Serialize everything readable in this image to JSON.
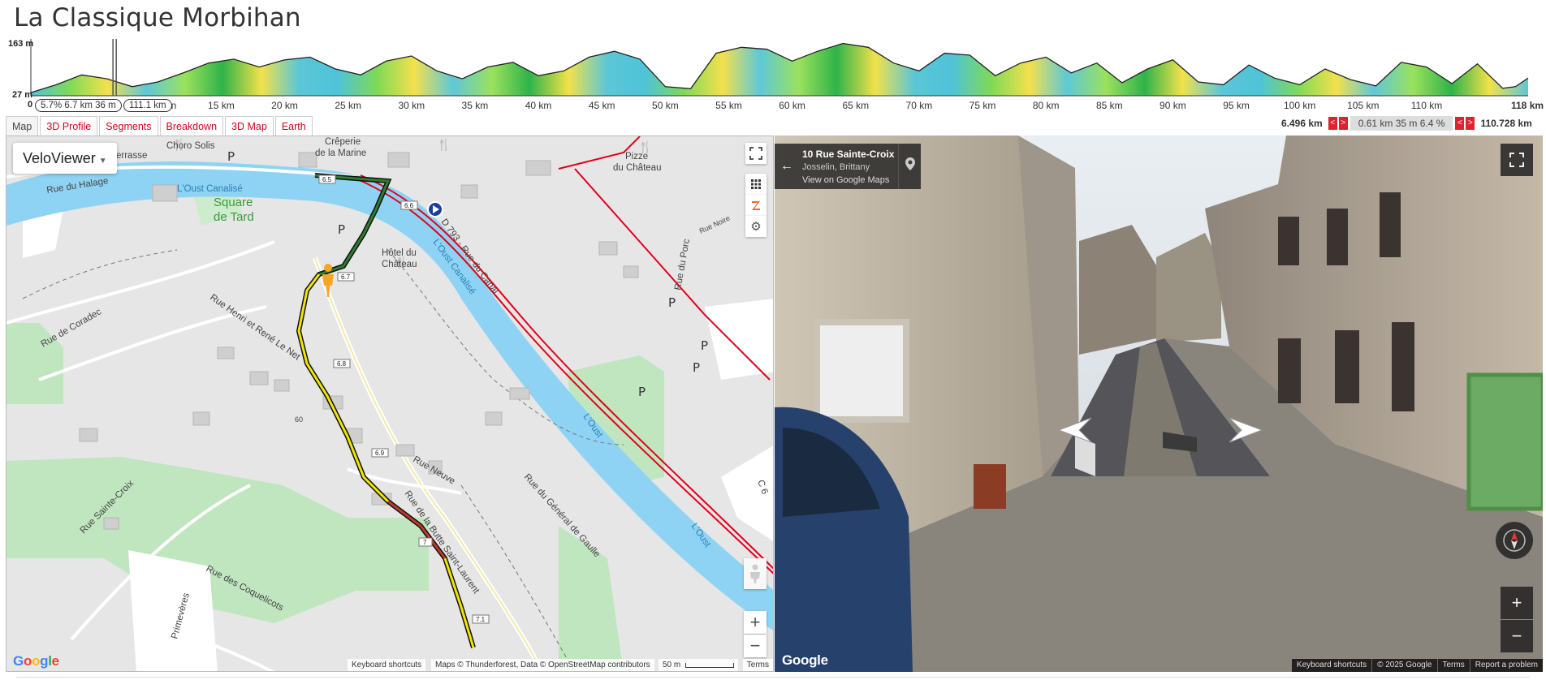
{
  "page": {
    "title": "La Classique Morbihan"
  },
  "elevation": {
    "max_label": "163 m",
    "min_label": "27 m",
    "start_label": "0",
    "end_label": "118 km",
    "km_labels": [
      "15 km",
      "20 km",
      "25 km",
      "30 km",
      "35 km",
      "40 km",
      "45 km",
      "50 km",
      "55 km",
      "60 km",
      "65 km",
      "70 km",
      "75 km",
      "80 km",
      "85 km",
      "90 km",
      "95 km",
      "100 km",
      "105 km",
      "110 km"
    ],
    "km_values": [
      15,
      20,
      25,
      30,
      35,
      40,
      45,
      50,
      55,
      60,
      65,
      70,
      75,
      80,
      85,
      90,
      95,
      100,
      105,
      110
    ],
    "total_km": 118,
    "min_m": 27,
    "max_m": 163,
    "cursor_km": 6.6,
    "segment_pill": "5.7% 6.7 km 36 m",
    "distance_pill": "111.1 km",
    "pill_suffix": "n",
    "profile_km": [
      0,
      2,
      4,
      6,
      7,
      8,
      10,
      12,
      14,
      16,
      18,
      20,
      22,
      24,
      26,
      28,
      30,
      32,
      34,
      36,
      38,
      40,
      42,
      44,
      46,
      48,
      50,
      52,
      54,
      56,
      58,
      60,
      62,
      64,
      66,
      68,
      70,
      72,
      74,
      76,
      78,
      80,
      82,
      84,
      86,
      88,
      90,
      92,
      94,
      96,
      98,
      100,
      102,
      104,
      106,
      108,
      110,
      112,
      114,
      116,
      117,
      118
    ],
    "profile_m": [
      35,
      55,
      80,
      70,
      60,
      50,
      62,
      85,
      110,
      120,
      100,
      118,
      125,
      95,
      80,
      115,
      128,
      90,
      70,
      100,
      112,
      78,
      90,
      125,
      140,
      120,
      50,
      45,
      135,
      150,
      145,
      115,
      140,
      160,
      150,
      110,
      90,
      135,
      130,
      78,
      110,
      125,
      85,
      110,
      60,
      95,
      118,
      62,
      55,
      105,
      72,
      55,
      95,
      68,
      52,
      112,
      100,
      58,
      108,
      46,
      50,
      72
    ]
  },
  "tabs": [
    {
      "label": "Map",
      "active": true
    },
    {
      "label": "3D Profile",
      "active": false
    },
    {
      "label": "Segments",
      "active": false
    },
    {
      "label": "Breakdown",
      "active": false
    },
    {
      "label": "3D Map",
      "active": false
    },
    {
      "label": "Earth",
      "active": false
    }
  ],
  "range": {
    "start": "6.496 km",
    "end": "110.728 km",
    "summary": "0.61 km 35 m 6.4 %",
    "arrows": "<>"
  },
  "map": {
    "provider_button": "VeloViewer",
    "labels": {
      "terrasse": "errasse",
      "choro": "Choro Solis",
      "creperie": "Crêperie",
      "de_la_marine": "de la Marine",
      "pizzeria": "Pizze",
      "du_chateau": "du Château",
      "rue_du_halage": "Rue du Halage",
      "oust_canalise_1": "L'Oust Canalisé",
      "square": "Square",
      "de_tard": "de Tard",
      "d793": "D 793 - Rue du Canal",
      "oust_canalise_2": "L'Oust Canalisé",
      "hotel": "Hôtel du",
      "chateau": "Château",
      "rue_du_porc": "Rue du Porc",
      "rue_noire": "Rue Noire",
      "rue_de_coradec": "Rue de Coradec",
      "rue_henri": "Rue Henri et René Le Net",
      "loust_1": "L'Oust",
      "loust_2": "L'Oust",
      "rue_neuve": "Rue Neuve",
      "rue_sainte_croix": "Rue Sainte-Croix",
      "rue_butte": "Rue de la Butte Saint-Laurent",
      "rue_general": "Rue du Général de Gaulle",
      "rue_coquelicots": "Rue des Coquelicots",
      "primeveres": "Primevères",
      "c6": "C 6",
      "elev_60": "60",
      "p": "P"
    },
    "km_markers": [
      "6.5",
      "6.6",
      "6.7",
      "6.8",
      "6.9",
      "7",
      "7.1"
    ],
    "attribution": {
      "shortcuts": "Keyboard shortcuts",
      "data": "Maps © Thunderforest, Data © OpenStreetMap contributors",
      "scale": "50 m",
      "terms": "Terms"
    },
    "logo": "Google",
    "colors": {
      "river": "#8fd3f4",
      "park": "#b8e6b8",
      "land": "#e8e8e8",
      "road_red": "#e2001a"
    }
  },
  "streetview": {
    "address": "10 Rue Sainte-Croix",
    "city": "Josselin, Brittany",
    "link": "View on Google Maps",
    "logo": "Google",
    "attribution": {
      "shortcuts": "Keyboard shortcuts",
      "copyright": "© 2025 Google",
      "terms": "Terms",
      "report": "Report a problem"
    }
  },
  "controls": {
    "fullscreen_icon": "fullscreen-icon",
    "plus": "+",
    "minus": "−"
  }
}
